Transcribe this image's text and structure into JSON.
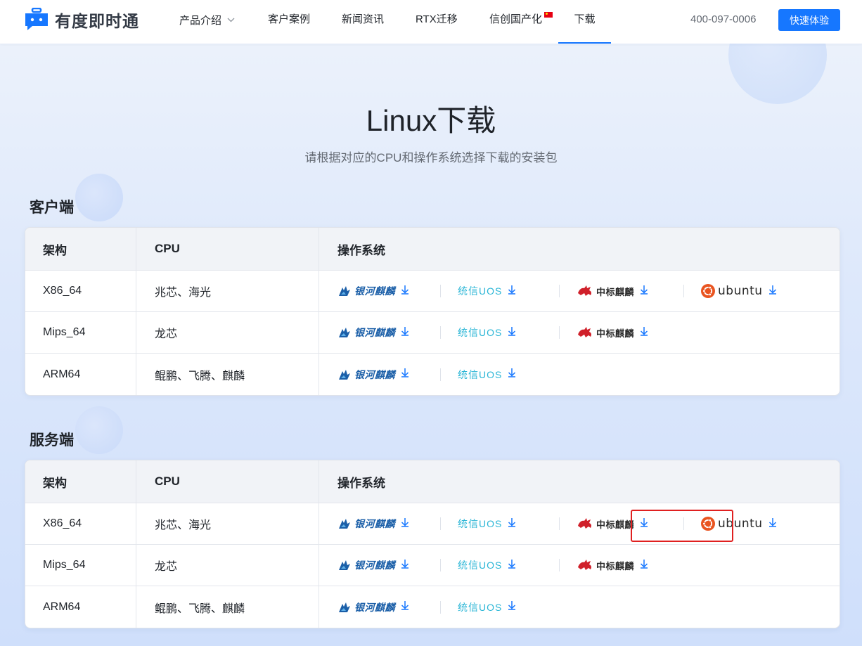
{
  "brand": {
    "name": "有度即时通"
  },
  "nav": {
    "items": [
      {
        "label": "产品介绍"
      },
      {
        "label": "客户案例"
      },
      {
        "label": "新闻资讯"
      },
      {
        "label": "RTX迁移"
      },
      {
        "label": "信创国产化"
      },
      {
        "label": "下载"
      }
    ],
    "active": "下载"
  },
  "header": {
    "phone": "400-097-0006",
    "cta_label": "快速体验"
  },
  "hero": {
    "title": "Linux下载",
    "subtitle": "请根据对应的CPU和操作系统选择下载的安装包"
  },
  "os_labels": {
    "yinhe": "银河麒麟",
    "uos": "统信UOS",
    "zhongbiao": "中标麒麟",
    "ubuntu": "ubuntu"
  },
  "columns": [
    "架构",
    "CPU",
    "操作系统"
  ],
  "sections": [
    {
      "title": "客户端",
      "rows": [
        {
          "arch": "X86_64",
          "cpu": "兆芯、海光",
          "os": [
            "yinhe",
            "uos",
            "zhongbiao",
            "ubuntu"
          ]
        },
        {
          "arch": "Mips_64",
          "cpu": "龙芯",
          "os": [
            "yinhe",
            "uos",
            "zhongbiao"
          ]
        },
        {
          "arch": "ARM64",
          "cpu": "鲲鹏、飞腾、麒麟",
          "os": [
            "yinhe",
            "uos"
          ]
        }
      ]
    },
    {
      "title": "服务端",
      "rows": [
        {
          "arch": "X86_64",
          "cpu": "兆芯、海光",
          "os": [
            "yinhe",
            "uos",
            "zhongbiao",
            "ubuntu"
          ]
        },
        {
          "arch": "Mips_64",
          "cpu": "龙芯",
          "os": [
            "yinhe",
            "uos",
            "zhongbiao"
          ]
        },
        {
          "arch": "ARM64",
          "cpu": "鲲鹏、飞腾、麒麟",
          "os": [
            "yinhe",
            "uos"
          ]
        }
      ]
    }
  ],
  "colors": {
    "accent": "#1677ff",
    "highlight": "#e02020",
    "uos": "#2bb6d6",
    "yinhe": "#1b5fa8",
    "ubuntu": "#e95420"
  }
}
